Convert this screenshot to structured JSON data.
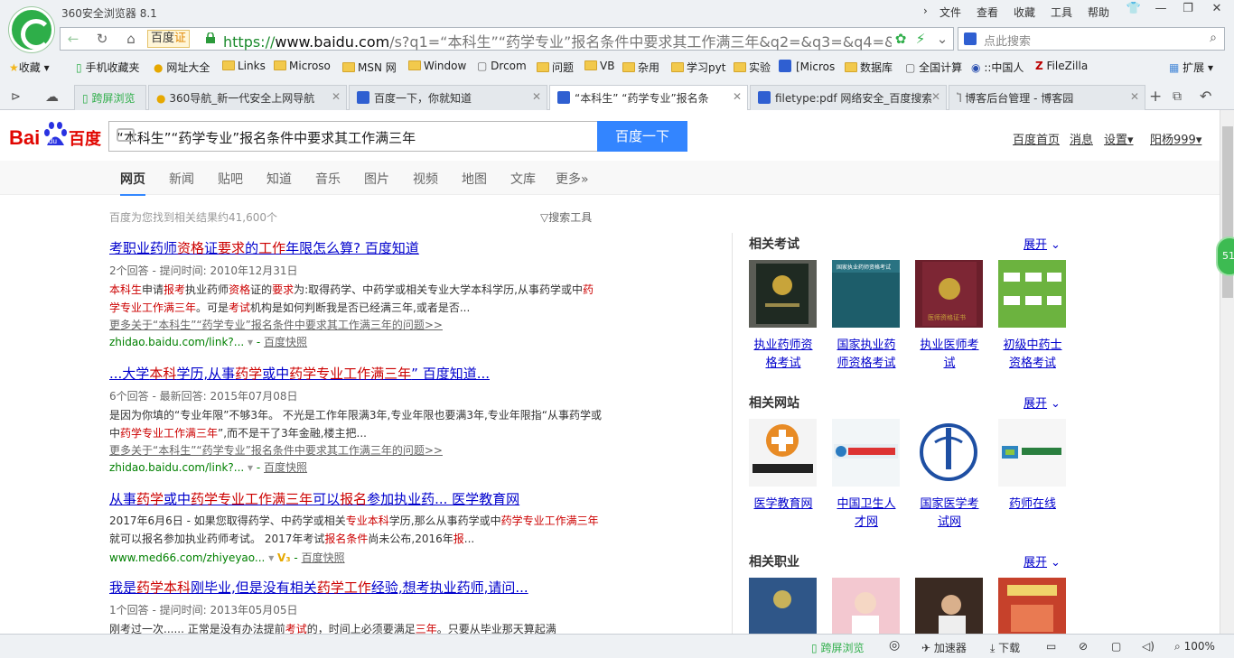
{
  "window": {
    "title": "360安全浏览器 8.1",
    "menu": [
      "文件",
      "查看",
      "收藏",
      "工具",
      "帮助"
    ]
  },
  "addressbar": {
    "mode_badge": "百度",
    "mode_icon": "证",
    "url_scheme": "https://",
    "url_host": "www.baidu.com",
    "url_rest": "/s?q1=“本科生”“药学专业”报名条件中要求其工作满三年&q2=&q3=&q4=&g"
  },
  "searchbox": {
    "placeholder": "点此搜索"
  },
  "bookmarks": [
    "收藏",
    "手机收藏夹",
    "网址大全",
    "Links",
    "Microso",
    "MSN 网",
    "Window",
    "Drcom",
    "问题",
    "VB",
    "杂用",
    "学习pyt",
    "实验",
    "[Micros",
    "数据库",
    "全国计算",
    "::中国人",
    "FileZilla",
    "扩展"
  ],
  "tabs": [
    {
      "label": "跨屏浏览"
    },
    {
      "label": "360导航_新一代安全上网导航"
    },
    {
      "label": "百度一下，你就知道"
    },
    {
      "label": "“本科生” “药学专业”报名条"
    },
    {
      "label": "filetype:pdf 网络安全_百度搜索"
    },
    {
      "label": "博客后台管理 - 博客园"
    }
  ],
  "baidu": {
    "query": "“本科生”“药学专业”报名条件中要求其工作满三年",
    "search_button": "百度一下",
    "top_links": [
      "百度首页",
      "消息",
      "设置",
      "阳杨999"
    ],
    "nav": [
      "网页",
      "新闻",
      "贴吧",
      "知道",
      "音乐",
      "图片",
      "视频",
      "地图",
      "文库",
      "更多»"
    ],
    "result_count": "百度为您找到相关结果约41,600个",
    "search_tools": "搜索工具"
  },
  "results": [
    {
      "title_html": "考职业药师<em>资格</em>证<em>要求</em>的<em>工作</em>年限怎么算? 百度知道",
      "meta": "2个回答 - 提问时间: 2010年12月31日",
      "abstract_html": "<em>本科生</em>申请<em>报考</em>执业药师<em>资格</em>证的<em>要求</em>为:取得药学、中药学或相关专业大学本科学历,从事药学或中<em>药学专业工作满三年</em>。可是<em>考试</em>机构是如何判断我是否已经满三年,或者是否...",
      "more": "更多关于“本科生”“药学专业”报名条件中要求其工作满三年的问题>>",
      "url": "zhidao.baidu.com/link?...",
      "snapshot": "百度快照"
    },
    {
      "title_html": "...大学<em>本科</em>学历,从事<em>药学</em>或中<em>药学专业工作满三年</em>” 百度知道...",
      "meta": "6个回答 - 最新回答: 2015年07月08日",
      "abstract_html": "是因为你填的“专业年限”不够3年。 不光是工作年限满3年,专业年限也要满3年,专业年限指“从事药学或中<em>药学专业工作满三年</em>”,而不是干了3年金融,楼主把...",
      "more": "更多关于“本科生”“药学专业”报名条件中要求其工作满三年的问题>>",
      "url": "zhidao.baidu.com/link?...",
      "snapshot": "百度快照"
    },
    {
      "title_html": "从事<em>药学</em>或中<em>药学专业工作满三年</em>可以<em>报名</em>参加执业药... 医学教育网",
      "meta": "",
      "abstract_html": "2017年6月6日 - 如果您取得药学、中药学或相关<em>专业本科</em>学历,那么从事药学或中<em>药学专业工作满三年</em>就可以报名参加执业药师考试。 2017年考试<em>报名条件</em>尚未公布,2016年<em>报</em>...",
      "more": "",
      "url": "www.med66.com/zhiyeyao...",
      "snapshot": "百度快照"
    },
    {
      "title_html": "我是<em>药学本科</em>刚毕业,但是没有相关<em>药学工作</em>经验,想考执业药师,请问...",
      "meta": "1个回答 - 提问时间: 2013年05月05日",
      "abstract_html": "刚考过一次...... 正常是没有办法提前<em>考试</em>的，时间上必须要满足<em>三年</em>。只要从毕业那天算起满",
      "more": "",
      "url": "",
      "snapshot": ""
    }
  ],
  "sidebar": {
    "sections": [
      {
        "title": "相关考试",
        "expand": "展开",
        "items": [
          "执业药师资格考试",
          "国家执业药师资格考试",
          "执业医师考试",
          "初级中药士资格考试"
        ]
      },
      {
        "title": "相关网站",
        "expand": "展开",
        "items": [
          "医学教育网",
          "中国卫生人才网",
          "国家医学考试网",
          "药师在线"
        ]
      },
      {
        "title": "相关职业",
        "expand": "展开",
        "items": [
          "",
          "",
          "",
          ""
        ]
      }
    ]
  },
  "statusbar": {
    "items": [
      "跨屏浏览",
      "加速器",
      "下载",
      "100%"
    ]
  },
  "float_badge": "51"
}
